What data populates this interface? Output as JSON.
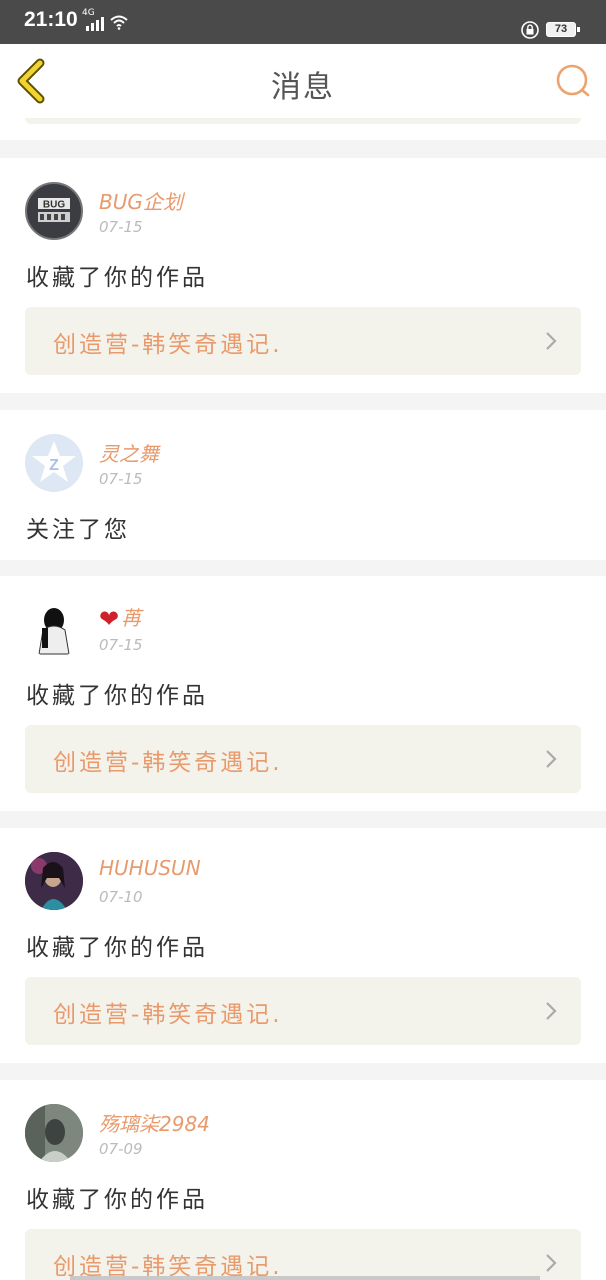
{
  "status": {
    "time": "21:10",
    "network": "4G",
    "battery": "73"
  },
  "header": {
    "title": "消息"
  },
  "messages": [
    {
      "user": "BUG企划",
      "date": "07-15",
      "action": "收藏了你的作品",
      "work": "创造营-韩笑奇遇记."
    },
    {
      "user": "灵之舞",
      "date": "07-15",
      "action": "关注了您",
      "work": ""
    },
    {
      "user": "苒",
      "date": "07-15",
      "action": "收藏了你的作品",
      "work": "创造营-韩笑奇遇记."
    },
    {
      "user": "HUHUSUN",
      "date": "07-10",
      "action": "收藏了你的作品",
      "work": "创造营-韩笑奇遇记."
    },
    {
      "user": "殇璃柒2984",
      "date": "07-09",
      "action": "收藏了你的作品",
      "work": "创造营-韩笑奇遇记."
    }
  ],
  "colors": {
    "accent": "#e89a6c",
    "card_bg": "#f3f3ec",
    "page_bg": "#f4f4f4"
  },
  "icons": [
    "back-chevron-icon",
    "search-icon",
    "chevron-right-icon",
    "wifi-icon",
    "signal-icon",
    "lock-icon"
  ]
}
